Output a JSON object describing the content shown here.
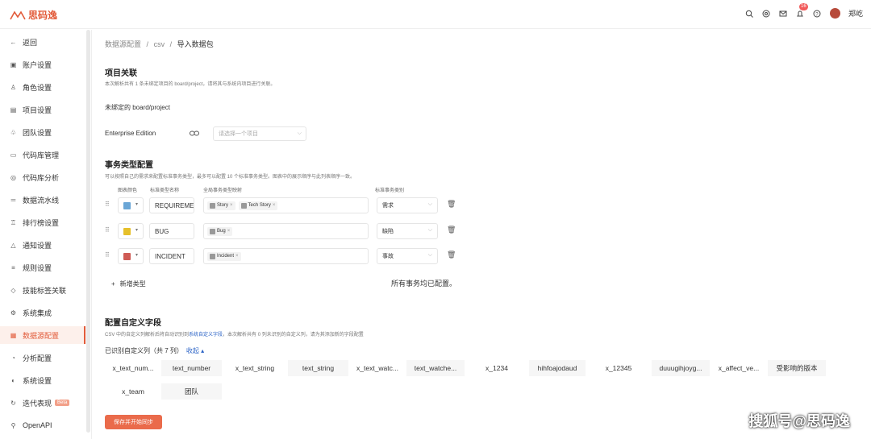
{
  "app": {
    "logo_text": "思码逸",
    "brand_color": "#e25b3a"
  },
  "topbar": {
    "notification_count": "16",
    "user_name": "郑屹",
    "icons": [
      "zoom-icon",
      "help-circle-icon",
      "mail-icon",
      "bell-icon",
      "question-icon"
    ]
  },
  "sidebar": {
    "items": [
      {
        "label": "返回",
        "icon": "arrow-left-icon"
      },
      {
        "label": "账户设置",
        "icon": "account-icon"
      },
      {
        "label": "角色设置",
        "icon": "user-icon"
      },
      {
        "label": "项目设置",
        "icon": "project-icon"
      },
      {
        "label": "团队设置",
        "icon": "team-icon"
      },
      {
        "label": "代码库管理",
        "icon": "repo-icon"
      },
      {
        "label": "代码库分析",
        "icon": "analysis-icon"
      },
      {
        "label": "数据流水线",
        "icon": "pipeline-icon"
      },
      {
        "label": "排行榜设置",
        "icon": "trophy-icon"
      },
      {
        "label": "通知设置",
        "icon": "bell-icon"
      },
      {
        "label": "规则设置",
        "icon": "rule-icon"
      },
      {
        "label": "技能标签关联",
        "icon": "tag-icon"
      },
      {
        "label": "系统集成",
        "icon": "integration-icon"
      },
      {
        "label": "数据源配置",
        "icon": "datasource-icon",
        "active": true
      },
      {
        "label": "分析配置",
        "icon": "settings-icon"
      },
      {
        "label": "系统设置",
        "icon": "system-icon"
      },
      {
        "label": "迭代表现",
        "icon": "iteration-icon",
        "badge": "Beta"
      },
      {
        "label": "OpenAPI",
        "icon": "api-icon"
      }
    ]
  },
  "breadcrumb": {
    "items": [
      "数据源配置",
      "csv"
    ],
    "current": "导入数据包",
    "sep": "/"
  },
  "project": {
    "title": "项目关联",
    "desc": "本次解析共有 1 条未绑定项目的 board/project，请将其与系统内项目进行关联。",
    "unbound_label": "未绑定的 board/project",
    "edition": "Enterprise Edition",
    "select_placeholder": "请选择一个项目"
  },
  "issue_types": {
    "title": "事务类型配置",
    "desc": "可以按照自己的需求来配置标准事务类型，最多可以配置 10 个标准事务类型。图表中的展示顺序与此列表顺序一致。",
    "col_color": "图表颜色",
    "col_name": "标准类型名称",
    "col_mapping": "全局事务类型映射",
    "col_standard": "标准事务类别",
    "rows": [
      {
        "color": "#6aa6d6",
        "name": "REQUIREMENT",
        "tags": [
          "Story",
          "Tech Story"
        ],
        "standard": "需求"
      },
      {
        "color": "#e6c02a",
        "name": "BUG",
        "tags": [
          "Bug"
        ],
        "standard": "缺陷"
      },
      {
        "color": "#cf5b55",
        "name": "INCIDENT",
        "tags": [
          "Incident"
        ],
        "standard": "事故"
      }
    ],
    "add_label": "新增类型",
    "all_configured": "所有事务均已配置。"
  },
  "custom_fields": {
    "title": "配置自定义字段",
    "desc_prefix": "CSV 中的自定义列解析后将自动识别到",
    "desc_link": "系统自定义字段",
    "desc_suffix": "，本次解析共有 0 列未识别的自定义列，请为其添加新的字段配置",
    "recognized": "已识别自定义列（共 7 列）",
    "collapse": "收起",
    "pairs": [
      {
        "key": "x_text_num...",
        "value": "text_number"
      },
      {
        "key": "x_text_string",
        "value": "text_string"
      },
      {
        "key": "x_text_watc...",
        "value": "text_watche..."
      },
      {
        "key": "x_1234",
        "value": "hihfoajodaud"
      },
      {
        "key": "x_12345",
        "value": "duuugihjoyg..."
      },
      {
        "key": "x_affect_ve...",
        "value": "受影响的版本"
      },
      {
        "key": "x_team",
        "value": "团队"
      }
    ]
  },
  "save_button": "保存并开始同步",
  "watermark": "搜狐号@思码逸"
}
